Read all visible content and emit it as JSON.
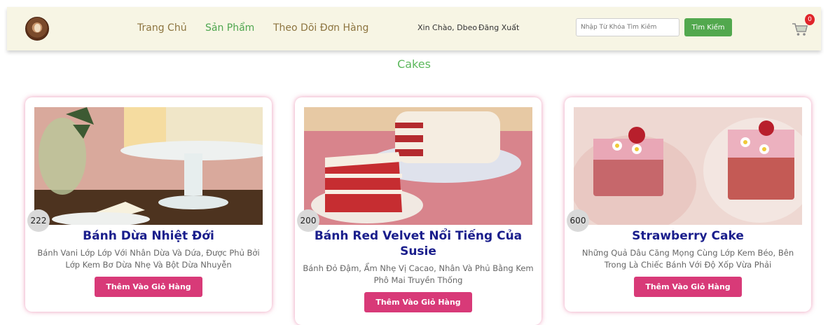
{
  "nav": {
    "home": "Trang Chủ",
    "products": "Sản Phẩm",
    "orders": "Theo Dõi Đơn Hàng",
    "greeting": "Xin Chào, Dbeo",
    "logout": "Đăng Xuất",
    "search_placeholder": "Nhập Từ Khóa Tìm Kiếm",
    "search_button": "Tìm Kiếm",
    "cart_count": "0"
  },
  "section_title": "Cakes",
  "products": [
    {
      "qty": "222",
      "title": "Bánh Dừa Nhiệt Đới",
      "desc": "Bánh Vani Lớp Lớp Với Nhân Dừa Và Dứa, Được Phủ Bởi Lớp Kem Bơ Dừa Nhẹ Và Bột Dừa Nhuyễn",
      "button": "Thêm Vào Giỏ Hàng"
    },
    {
      "qty": "200",
      "title": "Bánh Red Velvet Nổi Tiếng Của Susie",
      "desc": "Bánh Đỏ Đậm, Ẩm Nhẹ Vị Cacao, Nhân Và Phủ Bằng Kem Phô Mai Truyền Thống",
      "button": "Thêm Vào Giỏ Hàng"
    },
    {
      "qty": "600",
      "title": "Strawberry Cake",
      "desc": "Những Quả Dâu Căng Mọng Cùng Lớp Kem Béo, Bên Trong Là Chiếc Bánh Với Độ Xốp Vừa Phải",
      "button": "Thêm Vào Giỏ Hàng"
    }
  ]
}
